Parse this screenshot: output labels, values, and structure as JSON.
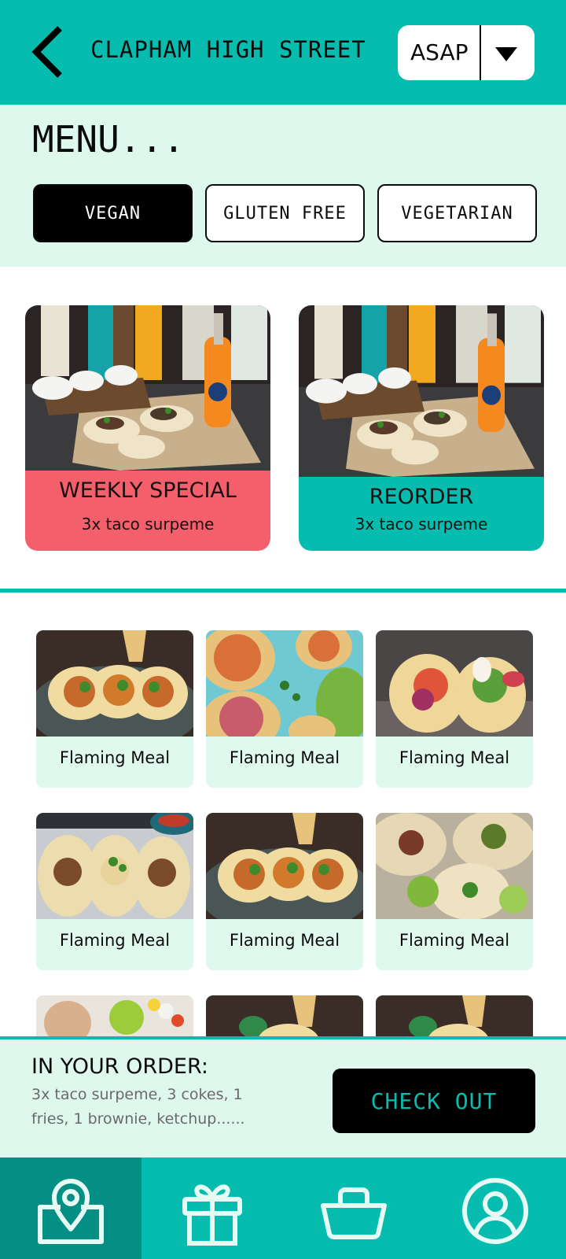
{
  "header": {
    "location": "CLAPHAM HIGH STREET",
    "time_value": "ASAP"
  },
  "menu": {
    "title": "MENU...",
    "filters": [
      {
        "label": "VEGAN",
        "active": true
      },
      {
        "label": "GLUTEN FREE",
        "active": false
      },
      {
        "label": "VEGETARIAN",
        "active": false
      }
    ]
  },
  "promos": [
    {
      "title": "WEEKLY SPECIAL",
      "subtitle": "3x taco surpeme",
      "color": "#f45f6c"
    },
    {
      "title": "REORDER",
      "subtitle": "3x taco surpeme",
      "color": "#06bcae"
    }
  ],
  "meals": [
    {
      "label": "Flaming Meal"
    },
    {
      "label": "Flaming Meal"
    },
    {
      "label": "Flaming Meal"
    },
    {
      "label": "Flaming Meal"
    },
    {
      "label": "Flaming Meal"
    },
    {
      "label": "Flaming Meal"
    },
    {
      "label": ""
    },
    {
      "label": ""
    },
    {
      "label": ""
    }
  ],
  "order": {
    "title": "IN YOUR ORDER:",
    "detail": "3x taco surpeme, 3 cokes, 1 fries, 1 brownie, ketchup......",
    "checkout_label": "CHECK OUT"
  },
  "nav": {
    "items": [
      {
        "icon": "location-pin-icon",
        "active": true
      },
      {
        "icon": "gift-icon",
        "active": false
      },
      {
        "icon": "basket-icon",
        "active": false
      },
      {
        "icon": "account-icon",
        "active": false
      }
    ]
  },
  "colors": {
    "brand_teal": "#06bcae",
    "mint": "#dff8ee",
    "special_red": "#f45f6c",
    "nav_active": "#048f85"
  }
}
